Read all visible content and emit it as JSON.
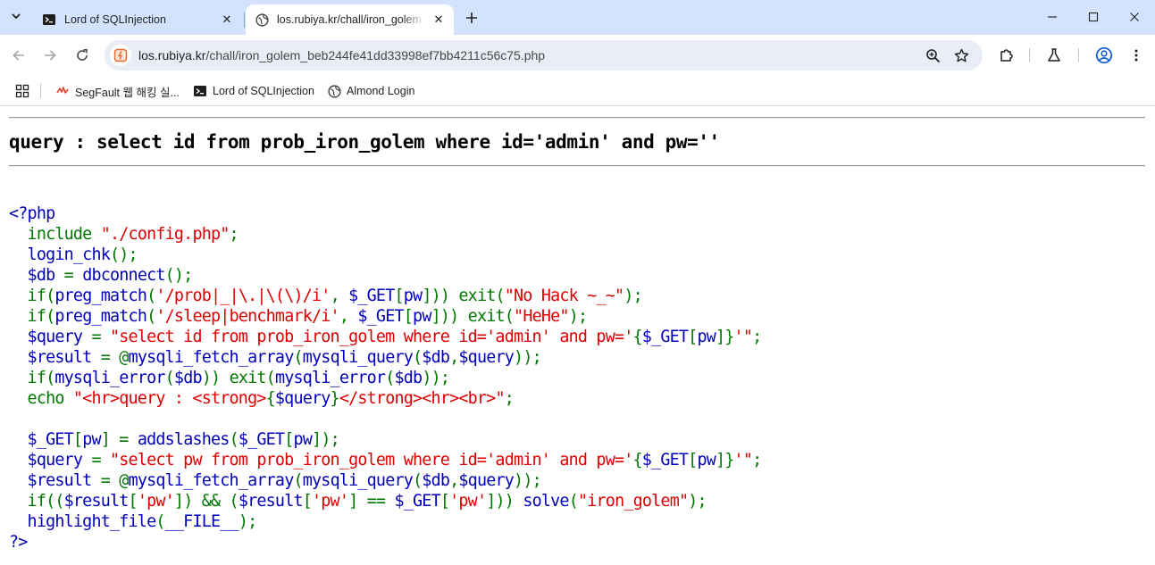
{
  "colors": {
    "tabstrip_bg": "#d3e3fd",
    "omnibox_bg": "#e9eef6",
    "php_default": "#0000BB",
    "php_keyword": "#007700",
    "php_string": "#DD0000"
  },
  "tabs": [
    {
      "title": "Lord of SQLInjection",
      "icon": "terminal-icon",
      "active": false
    },
    {
      "title": "los.rubiya.kr/chall/iron_golem_",
      "icon": "globe-icon",
      "active": true
    }
  ],
  "omnibox": {
    "url_host": "los.rubiya.kr",
    "url_path": "/chall/iron_golem_beb244fe41dd33998ef7bb4211c56c75.php"
  },
  "bookmarks": [
    {
      "label": "SegFault 웹 해킹 실...",
      "icon": "segfault-icon"
    },
    {
      "label": "Lord of SQLInjection",
      "icon": "terminal-icon"
    },
    {
      "label": "Almond Login",
      "icon": "globe-icon"
    }
  ],
  "page": {
    "query_text": "query : select id from prob_iron_golem where id='admin' and pw=''",
    "code_lines": [
      [
        {
          "c": "d",
          "t": "<?php"
        }
      ],
      [
        {
          "c": "k",
          "t": "  include "
        },
        {
          "c": "s",
          "t": "\"./config.php\""
        },
        {
          "c": "k",
          "t": ";"
        }
      ],
      [
        {
          "c": "d",
          "t": "  login_chk"
        },
        {
          "c": "k",
          "t": "();"
        }
      ],
      [
        {
          "c": "d",
          "t": "  $db "
        },
        {
          "c": "k",
          "t": "= "
        },
        {
          "c": "d",
          "t": "dbconnect"
        },
        {
          "c": "k",
          "t": "();"
        }
      ],
      [
        {
          "c": "k",
          "t": "  if("
        },
        {
          "c": "d",
          "t": "preg_match"
        },
        {
          "c": "k",
          "t": "("
        },
        {
          "c": "s",
          "t": "'/prob|_|\\.|\\(\\)/i'"
        },
        {
          "c": "k",
          "t": ", "
        },
        {
          "c": "d",
          "t": "$_GET"
        },
        {
          "c": "k",
          "t": "["
        },
        {
          "c": "d",
          "t": "pw"
        },
        {
          "c": "k",
          "t": "])) exit("
        },
        {
          "c": "s",
          "t": "\"No Hack ~_~\""
        },
        {
          "c": "k",
          "t": ");"
        }
      ],
      [
        {
          "c": "k",
          "t": "  if("
        },
        {
          "c": "d",
          "t": "preg_match"
        },
        {
          "c": "k",
          "t": "("
        },
        {
          "c": "s",
          "t": "'/sleep|benchmark/i'"
        },
        {
          "c": "k",
          "t": ", "
        },
        {
          "c": "d",
          "t": "$_GET"
        },
        {
          "c": "k",
          "t": "["
        },
        {
          "c": "d",
          "t": "pw"
        },
        {
          "c": "k",
          "t": "])) exit("
        },
        {
          "c": "s",
          "t": "\"HeHe\""
        },
        {
          "c": "k",
          "t": ");"
        }
      ],
      [
        {
          "c": "d",
          "t": "  $query "
        },
        {
          "c": "k",
          "t": "= "
        },
        {
          "c": "s",
          "t": "\"select id from prob_iron_golem where id='admin' and pw='"
        },
        {
          "c": "k",
          "t": "{"
        },
        {
          "c": "d",
          "t": "$_GET"
        },
        {
          "c": "k",
          "t": "["
        },
        {
          "c": "d",
          "t": "pw"
        },
        {
          "c": "k",
          "t": "]}"
        },
        {
          "c": "s",
          "t": "'\""
        },
        {
          "c": "k",
          "t": ";"
        }
      ],
      [
        {
          "c": "d",
          "t": "  $result "
        },
        {
          "c": "k",
          "t": "= @"
        },
        {
          "c": "d",
          "t": "mysqli_fetch_array"
        },
        {
          "c": "k",
          "t": "("
        },
        {
          "c": "d",
          "t": "mysqli_query"
        },
        {
          "c": "k",
          "t": "("
        },
        {
          "c": "d",
          "t": "$db"
        },
        {
          "c": "k",
          "t": ","
        },
        {
          "c": "d",
          "t": "$query"
        },
        {
          "c": "k",
          "t": "));"
        }
      ],
      [
        {
          "c": "k",
          "t": "  if("
        },
        {
          "c": "d",
          "t": "mysqli_error"
        },
        {
          "c": "k",
          "t": "("
        },
        {
          "c": "d",
          "t": "$db"
        },
        {
          "c": "k",
          "t": ")) exit("
        },
        {
          "c": "d",
          "t": "mysqli_error"
        },
        {
          "c": "k",
          "t": "("
        },
        {
          "c": "d",
          "t": "$db"
        },
        {
          "c": "k",
          "t": "));"
        }
      ],
      [
        {
          "c": "k",
          "t": "  echo "
        },
        {
          "c": "s",
          "t": "\"<hr>query : <strong>"
        },
        {
          "c": "k",
          "t": "{"
        },
        {
          "c": "d",
          "t": "$query"
        },
        {
          "c": "k",
          "t": "}"
        },
        {
          "c": "s",
          "t": "</strong><hr><br>\""
        },
        {
          "c": "k",
          "t": ";"
        }
      ],
      [
        {
          "c": "d",
          "t": ""
        }
      ],
      [
        {
          "c": "d",
          "t": "  $_GET"
        },
        {
          "c": "k",
          "t": "["
        },
        {
          "c": "d",
          "t": "pw"
        },
        {
          "c": "k",
          "t": "] = "
        },
        {
          "c": "d",
          "t": "addslashes"
        },
        {
          "c": "k",
          "t": "("
        },
        {
          "c": "d",
          "t": "$_GET"
        },
        {
          "c": "k",
          "t": "["
        },
        {
          "c": "d",
          "t": "pw"
        },
        {
          "c": "k",
          "t": "]);"
        }
      ],
      [
        {
          "c": "d",
          "t": "  $query "
        },
        {
          "c": "k",
          "t": "= "
        },
        {
          "c": "s",
          "t": "\"select pw from prob_iron_golem where id='admin' and pw='"
        },
        {
          "c": "k",
          "t": "{"
        },
        {
          "c": "d",
          "t": "$_GET"
        },
        {
          "c": "k",
          "t": "["
        },
        {
          "c": "d",
          "t": "pw"
        },
        {
          "c": "k",
          "t": "]}"
        },
        {
          "c": "s",
          "t": "'\""
        },
        {
          "c": "k",
          "t": ";"
        }
      ],
      [
        {
          "c": "d",
          "t": "  $result "
        },
        {
          "c": "k",
          "t": "= @"
        },
        {
          "c": "d",
          "t": "mysqli_fetch_array"
        },
        {
          "c": "k",
          "t": "("
        },
        {
          "c": "d",
          "t": "mysqli_query"
        },
        {
          "c": "k",
          "t": "("
        },
        {
          "c": "d",
          "t": "$db"
        },
        {
          "c": "k",
          "t": ","
        },
        {
          "c": "d",
          "t": "$query"
        },
        {
          "c": "k",
          "t": "));"
        }
      ],
      [
        {
          "c": "k",
          "t": "  if(("
        },
        {
          "c": "d",
          "t": "$result"
        },
        {
          "c": "k",
          "t": "["
        },
        {
          "c": "s",
          "t": "'pw'"
        },
        {
          "c": "k",
          "t": "]) && ("
        },
        {
          "c": "d",
          "t": "$result"
        },
        {
          "c": "k",
          "t": "["
        },
        {
          "c": "s",
          "t": "'pw'"
        },
        {
          "c": "k",
          "t": "] == "
        },
        {
          "c": "d",
          "t": "$_GET"
        },
        {
          "c": "k",
          "t": "["
        },
        {
          "c": "s",
          "t": "'pw'"
        },
        {
          "c": "k",
          "t": "])) "
        },
        {
          "c": "d",
          "t": "solve"
        },
        {
          "c": "k",
          "t": "("
        },
        {
          "c": "s",
          "t": "\"iron_golem\""
        },
        {
          "c": "k",
          "t": ");"
        }
      ],
      [
        {
          "c": "d",
          "t": "  highlight_file"
        },
        {
          "c": "k",
          "t": "("
        },
        {
          "c": "d",
          "t": "__FILE__"
        },
        {
          "c": "k",
          "t": ");"
        }
      ],
      [
        {
          "c": "d",
          "t": "?>"
        }
      ]
    ]
  }
}
